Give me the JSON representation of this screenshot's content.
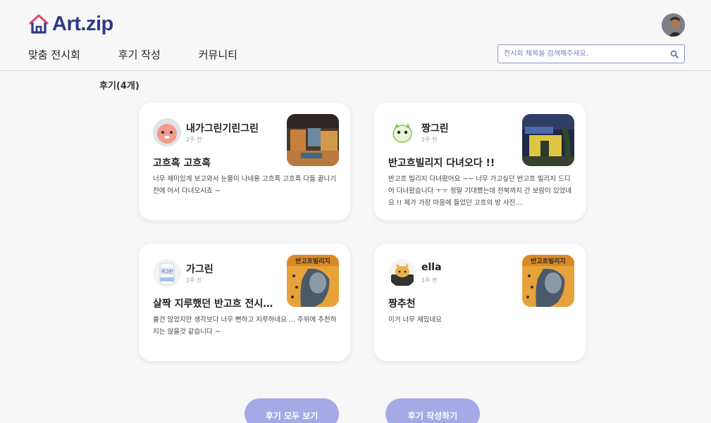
{
  "brand": {
    "name": "Art.zip",
    "color": "#2e3a87"
  },
  "nav": [
    "맞춤 전시회",
    "후기 작성",
    "커뮤니티"
  ],
  "search": {
    "placeholder": "전시회 제목을 검색해주세요."
  },
  "section": {
    "title": "후기(4개)"
  },
  "reviews": [
    {
      "user": "내가그린기린그린",
      "time": "2주 전",
      "title": "고흐흑 고흐흑",
      "body": "너무 재미있게 보고와서 눈물이 나네용 고흐흑 고흐흑 다들 끝나기 전에 어서 다녀오시죠 ~",
      "avatar_icon": "pink-character-icon",
      "thumb_icon": "exhibition-hall-photo"
    },
    {
      "user": "짱그린",
      "time": "2주 전",
      "title": "반고흐빌리지 다녀오다 !!",
      "body": "반고흐 빌리지 다녀왔어요 ~~ 너무 가고싶던 반고흐 빌리지 드디어 다녀왔습니다 ㅜㅜ 정말 기대했는데 전북까지 간 보람이 있었네요 !! 제가 가장 마음에 들었던 고흐의 방 사진…",
      "avatar_icon": "green-character-icon",
      "thumb_icon": "village-night-photo"
    },
    {
      "user": "가그린",
      "time": "2주 전",
      "title": "살짝 지루했던 반고흐 전시…",
      "body": "볼건 많았지만 생각보다 너무 뻔하고 지루하네요 ... 주위에 추천하지는 않을것 같습니다 ~",
      "avatar_icon": "mouthwash-bottle-icon",
      "thumb_icon": "van-gogh-poster"
    },
    {
      "user": "ella",
      "time": "1주 전",
      "title": "짱추천",
      "body": "이거 너무 재밌네요",
      "avatar_icon": "cat-character-icon",
      "thumb_icon": "van-gogh-poster"
    }
  ],
  "buttons": {
    "view_all": "후기 모두 보기",
    "write": "후기 작성하기"
  },
  "colors": {
    "accent": "#a5a9e6",
    "search_border": "#8f93c9"
  }
}
